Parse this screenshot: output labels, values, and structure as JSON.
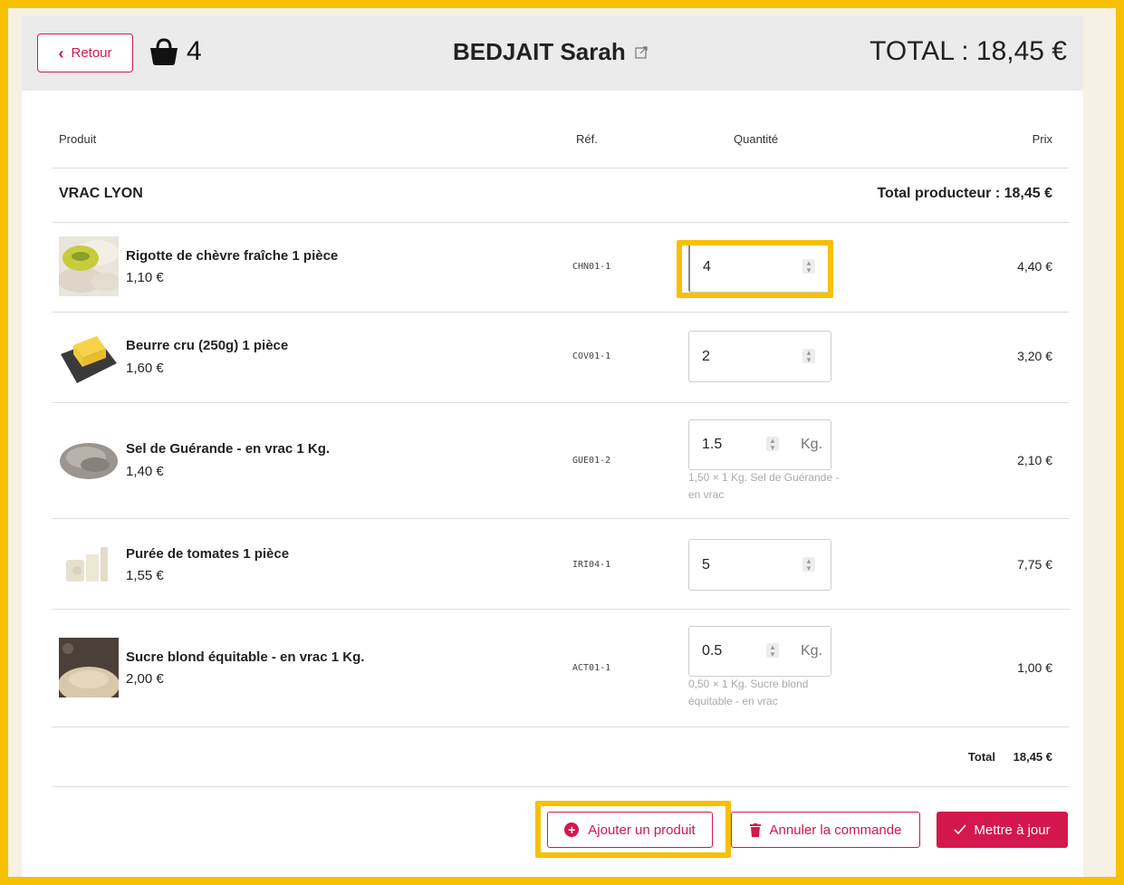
{
  "header": {
    "back_label": "Retour",
    "basket_count": "4",
    "customer_name": "BEDJAIT Sarah",
    "total_label": "TOTAL : 18,45 €"
  },
  "columns": {
    "product": "Produit",
    "ref": "Réf.",
    "quantity": "Quantité",
    "price": "Prix"
  },
  "producer": {
    "name": "VRAC LYON",
    "total_label": "Total producteur : 18,45 €"
  },
  "items": [
    {
      "name": "Rigotte de chèvre fraîche 1 pièce",
      "unit_price": "1,10 €",
      "ref": "CHN01-1",
      "quantity": "4",
      "unit": "",
      "help": "",
      "price": "4,40 €"
    },
    {
      "name": "Beurre cru (250g) 1 pièce",
      "unit_price": "1,60 €",
      "ref": "COV01-1",
      "quantity": "2",
      "unit": "",
      "help": "",
      "price": "3,20 €"
    },
    {
      "name": "Sel de Guérande - en vrac 1 Kg.",
      "unit_price": "1,40 €",
      "ref": "GUE01-2",
      "quantity": "1.5",
      "unit": "Kg.",
      "help": "1,50 × 1 Kg. Sel de Guérande - en vrac",
      "price": "2,10 €"
    },
    {
      "name": "Purée de tomates 1 pièce",
      "unit_price": "1,55 €",
      "ref": "IRI04-1",
      "quantity": "5",
      "unit": "",
      "help": "",
      "price": "7,75 €"
    },
    {
      "name": "Sucre blond équitable - en vrac 1 Kg.",
      "unit_price": "2,00 €",
      "ref": "ACT01-1",
      "quantity": "0.5",
      "unit": "Kg.",
      "help": "0,50 × 1 Kg. Sucre blond équitable - en vrac",
      "price": "1,00 €"
    }
  ],
  "footer": {
    "total_label": "Total",
    "total_value": "18,45 €"
  },
  "actions": {
    "add_product": "Ajouter un produit",
    "cancel_order": "Annuler la commande",
    "update": "Mettre à jour"
  },
  "colors": {
    "accent": "#d4174d",
    "highlight": "#f7c000"
  }
}
